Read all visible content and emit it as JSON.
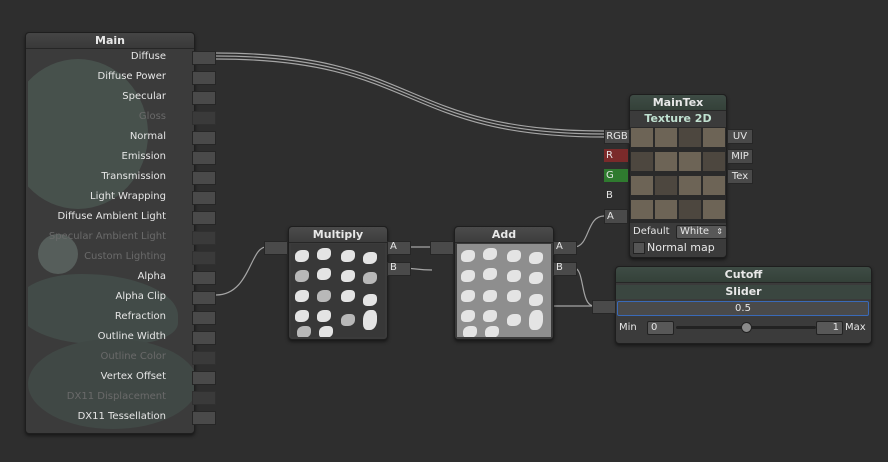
{
  "main_node": {
    "title": "Main",
    "inputs": [
      {
        "label": "Diffuse",
        "enabled": true
      },
      {
        "label": "Diffuse Power",
        "enabled": true
      },
      {
        "label": "Specular",
        "enabled": true
      },
      {
        "label": "Gloss",
        "enabled": false
      },
      {
        "label": "Normal",
        "enabled": true
      },
      {
        "label": "Emission",
        "enabled": true
      },
      {
        "label": "Transmission",
        "enabled": true
      },
      {
        "label": "Light Wrapping",
        "enabled": true
      },
      {
        "label": "Diffuse Ambient Light",
        "enabled": true
      },
      {
        "label": "Specular Ambient Light",
        "enabled": false
      },
      {
        "label": "Custom Lighting",
        "enabled": false
      },
      {
        "label": "Alpha",
        "enabled": true
      },
      {
        "label": "Alpha Clip",
        "enabled": true
      },
      {
        "label": "Refraction",
        "enabled": true
      },
      {
        "label": "Outline Width",
        "enabled": true
      },
      {
        "label": "Outline Color",
        "enabled": false
      },
      {
        "label": "Vertex Offset",
        "enabled": true
      },
      {
        "label": "DX11 Displacement",
        "enabled": false
      },
      {
        "label": "DX11 Tessellation",
        "enabled": true
      }
    ]
  },
  "multiply_node": {
    "title": "Multiply",
    "outputs": [
      "A",
      "B"
    ]
  },
  "add_node": {
    "title": "Add",
    "outputs": [
      "A",
      "B"
    ]
  },
  "maintex_node": {
    "name": "MainTex",
    "type": "Texture 2D",
    "channels": [
      "RGB",
      "R",
      "G",
      "B",
      "A"
    ],
    "channel_colors": {
      "R": "#7a2a2a",
      "G": "#2f7a2f"
    },
    "inputs": [
      "UV",
      "MIP",
      "Tex"
    ],
    "default_label": "Default",
    "default_value": "White",
    "normal_map_label": "Normal map",
    "normal_map_checked": false
  },
  "cutoff_node": {
    "name": "Cutoff",
    "type": "Slider",
    "value": "0.5",
    "min_label": "Min",
    "min_value": "0",
    "max_label": "Max",
    "max_value": "1",
    "slider_fraction": 0.5
  },
  "colors": {
    "background": "#2e2e2e",
    "node": "#3b3b3b",
    "wire": "#a8a8a8",
    "property_header": "#3a4a42",
    "slider_field_border": "#3a6ab8"
  }
}
